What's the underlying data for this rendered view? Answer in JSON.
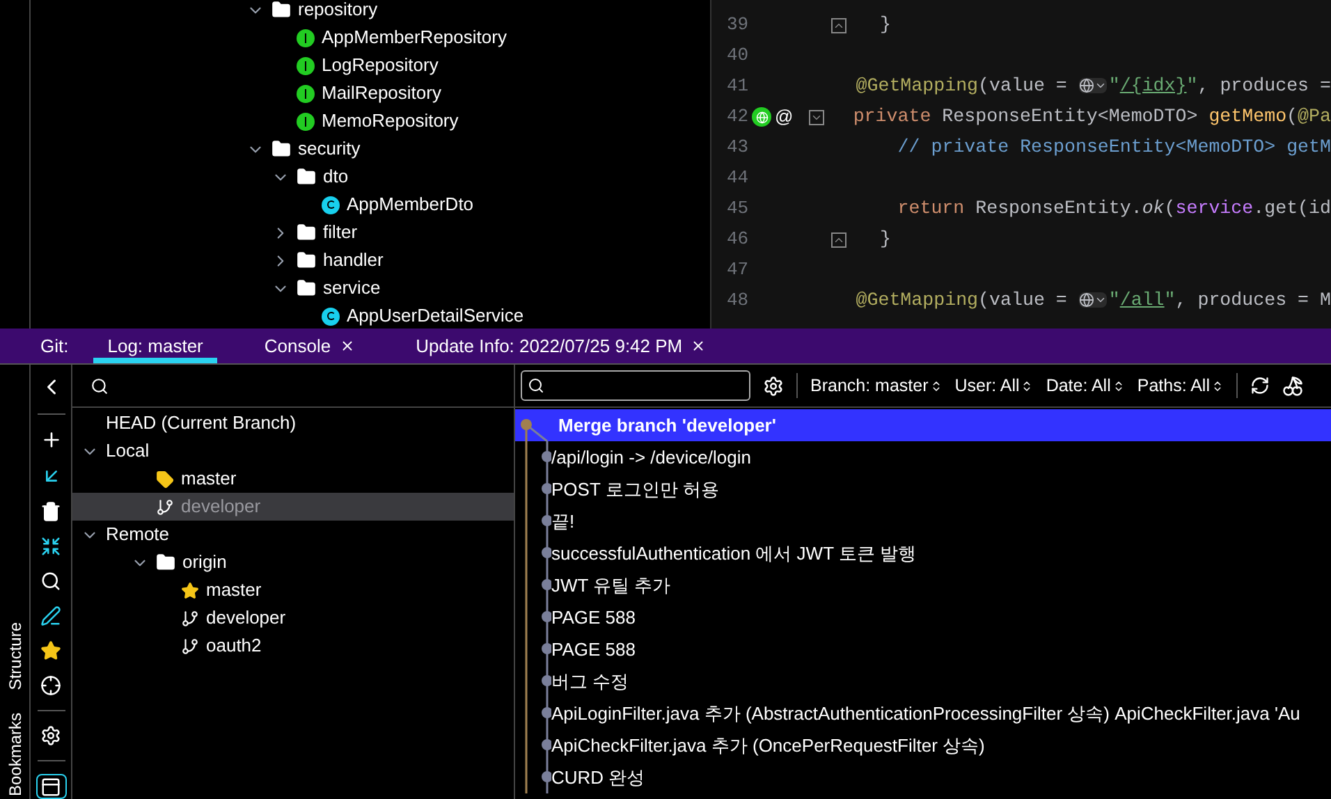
{
  "project_tree": [
    {
      "label": "repository",
      "kind": "folder",
      "expanded": true,
      "children": [
        {
          "label": "AppMemberRepository",
          "kind": "interface"
        },
        {
          "label": "LogRepository",
          "kind": "interface"
        },
        {
          "label": "MailRepository",
          "kind": "interface"
        },
        {
          "label": "MemoRepository",
          "kind": "interface"
        }
      ]
    },
    {
      "label": "security",
      "kind": "folder",
      "expanded": true,
      "children": [
        {
          "label": "dto",
          "kind": "folder",
          "expanded": true,
          "children": [
            {
              "label": "AppMemberDto",
              "kind": "class"
            }
          ]
        },
        {
          "label": "filter",
          "kind": "folder",
          "expanded": false
        },
        {
          "label": "handler",
          "kind": "folder",
          "expanded": false
        },
        {
          "label": "service",
          "kind": "folder",
          "expanded": true,
          "children": [
            {
              "label": "AppUserDetailService",
              "kind": "class"
            }
          ]
        }
      ]
    }
  ],
  "editor": {
    "lines": [
      {
        "number": "39",
        "indented": false,
        "fold_end": true,
        "tokens": [
          {
            "text": "}",
            "kind": "plain"
          }
        ]
      },
      {
        "number": "40"
      },
      {
        "number": "41",
        "indented": false,
        "tokens": [
          {
            "text": "@GetMapping",
            "kind": "annotation"
          },
          {
            "text": "(value = ",
            "kind": "plain"
          },
          {
            "kind": "url-chip"
          },
          {
            "text": "\"",
            "kind": "string"
          },
          {
            "text": "/{idx}",
            "kind": "link"
          },
          {
            "text": "\"",
            "kind": "string"
          },
          {
            "text": ", produces =",
            "kind": "plain"
          }
        ]
      },
      {
        "number": "42",
        "indented": false,
        "fold_start": true,
        "endpoint": true,
        "gutter_text": "@",
        "tokens": [
          {
            "text": "private",
            "kind": "keyword"
          },
          {
            "text": " ResponseEntity<MemoDTO> ",
            "kind": "plain"
          },
          {
            "text": "getMemo",
            "kind": "method"
          },
          {
            "text": "(",
            "kind": "plain"
          },
          {
            "text": "@Pa",
            "kind": "annotation"
          }
        ]
      },
      {
        "number": "43",
        "indented": true,
        "tokens": [
          {
            "text": "// private ResponseEntity<MemoDTO> getM",
            "kind": "comment"
          }
        ]
      },
      {
        "number": "44"
      },
      {
        "number": "45",
        "indented": true,
        "tokens": [
          {
            "text": "return",
            "kind": "keyword"
          },
          {
            "text": " ResponseEntity.",
            "kind": "plain"
          },
          {
            "text": "ok",
            "kind": "italic"
          },
          {
            "text": "(",
            "kind": "plain"
          },
          {
            "text": "service",
            "kind": "field"
          },
          {
            "text": ".get(id",
            "kind": "plain"
          }
        ]
      },
      {
        "number": "46",
        "indented": false,
        "fold_end": true,
        "tokens": [
          {
            "text": "}",
            "kind": "plain"
          }
        ]
      },
      {
        "number": "47"
      },
      {
        "number": "48",
        "indented": false,
        "tokens": [
          {
            "text": "@GetMapping",
            "kind": "annotation"
          },
          {
            "text": "(value = ",
            "kind": "plain"
          },
          {
            "kind": "url-chip"
          },
          {
            "text": "\"",
            "kind": "string"
          },
          {
            "text": "/all",
            "kind": "link"
          },
          {
            "text": "\"",
            "kind": "string"
          },
          {
            "text": ", produces = M",
            "kind": "plain"
          }
        ]
      }
    ]
  },
  "tool_window": {
    "label": "Git:",
    "tabs": [
      {
        "label": "Log: master",
        "selected": true,
        "closable": false
      },
      {
        "label": "Console",
        "selected": false,
        "closable": true
      },
      {
        "label": "Update Info: 2022/07/25 9:42 PM",
        "selected": false,
        "closable": true
      }
    ]
  },
  "side_stripe": [
    "Structure",
    "Bookmarks"
  ],
  "branches": [
    {
      "label": "HEAD (Current Branch)",
      "kind": "head",
      "selected": false
    },
    {
      "label": "Local",
      "kind": "group",
      "expanded": true,
      "selected": false,
      "children": [
        {
          "label": "master",
          "kind": "current",
          "selected": false
        },
        {
          "label": "developer",
          "kind": "branch",
          "selected": true
        }
      ]
    },
    {
      "label": "Remote",
      "kind": "group",
      "expanded": true,
      "selected": false,
      "children": [
        {
          "label": "origin",
          "kind": "folder",
          "expanded": true,
          "selected": false,
          "children": [
            {
              "label": "master",
              "kind": "favorite",
              "selected": false
            },
            {
              "label": "developer",
              "kind": "branch",
              "selected": false
            },
            {
              "label": "oauth2",
              "kind": "branch",
              "selected": false
            }
          ]
        }
      ]
    }
  ],
  "log_filters": [
    "Branch: master",
    "User: All",
    "Date: All",
    "Paths: All"
  ],
  "commits": [
    {
      "message": "Merge branch 'developer'",
      "kind": "merge",
      "selected": true
    },
    {
      "message": "/api/login -> /device/login",
      "kind": "commit",
      "selected": false
    },
    {
      "message": "POST 로그인만 허용",
      "kind": "commit",
      "selected": false
    },
    {
      "message": "끝!",
      "kind": "commit",
      "selected": false
    },
    {
      "message": "successfulAuthentication 에서 JWT 토큰 발행",
      "kind": "commit",
      "selected": false
    },
    {
      "message": "JWT 유틸 추가",
      "kind": "commit",
      "selected": false
    },
    {
      "message": "PAGE 588",
      "kind": "commit",
      "selected": false
    },
    {
      "message": "PAGE 588",
      "kind": "commit",
      "selected": false
    },
    {
      "message": "버그 수정",
      "kind": "commit",
      "selected": false
    },
    {
      "message": "ApiLoginFilter.java 추가 (AbstractAuthenticationProcessingFilter 상속) ApiCheckFilter.java 'Au",
      "kind": "commit",
      "selected": false
    },
    {
      "message": "ApiCheckFilter.java 추가 (OncePerRequestFilter 상속)",
      "kind": "commit",
      "selected": false
    },
    {
      "message": "CURD 완성",
      "kind": "commit",
      "selected": false
    }
  ]
}
